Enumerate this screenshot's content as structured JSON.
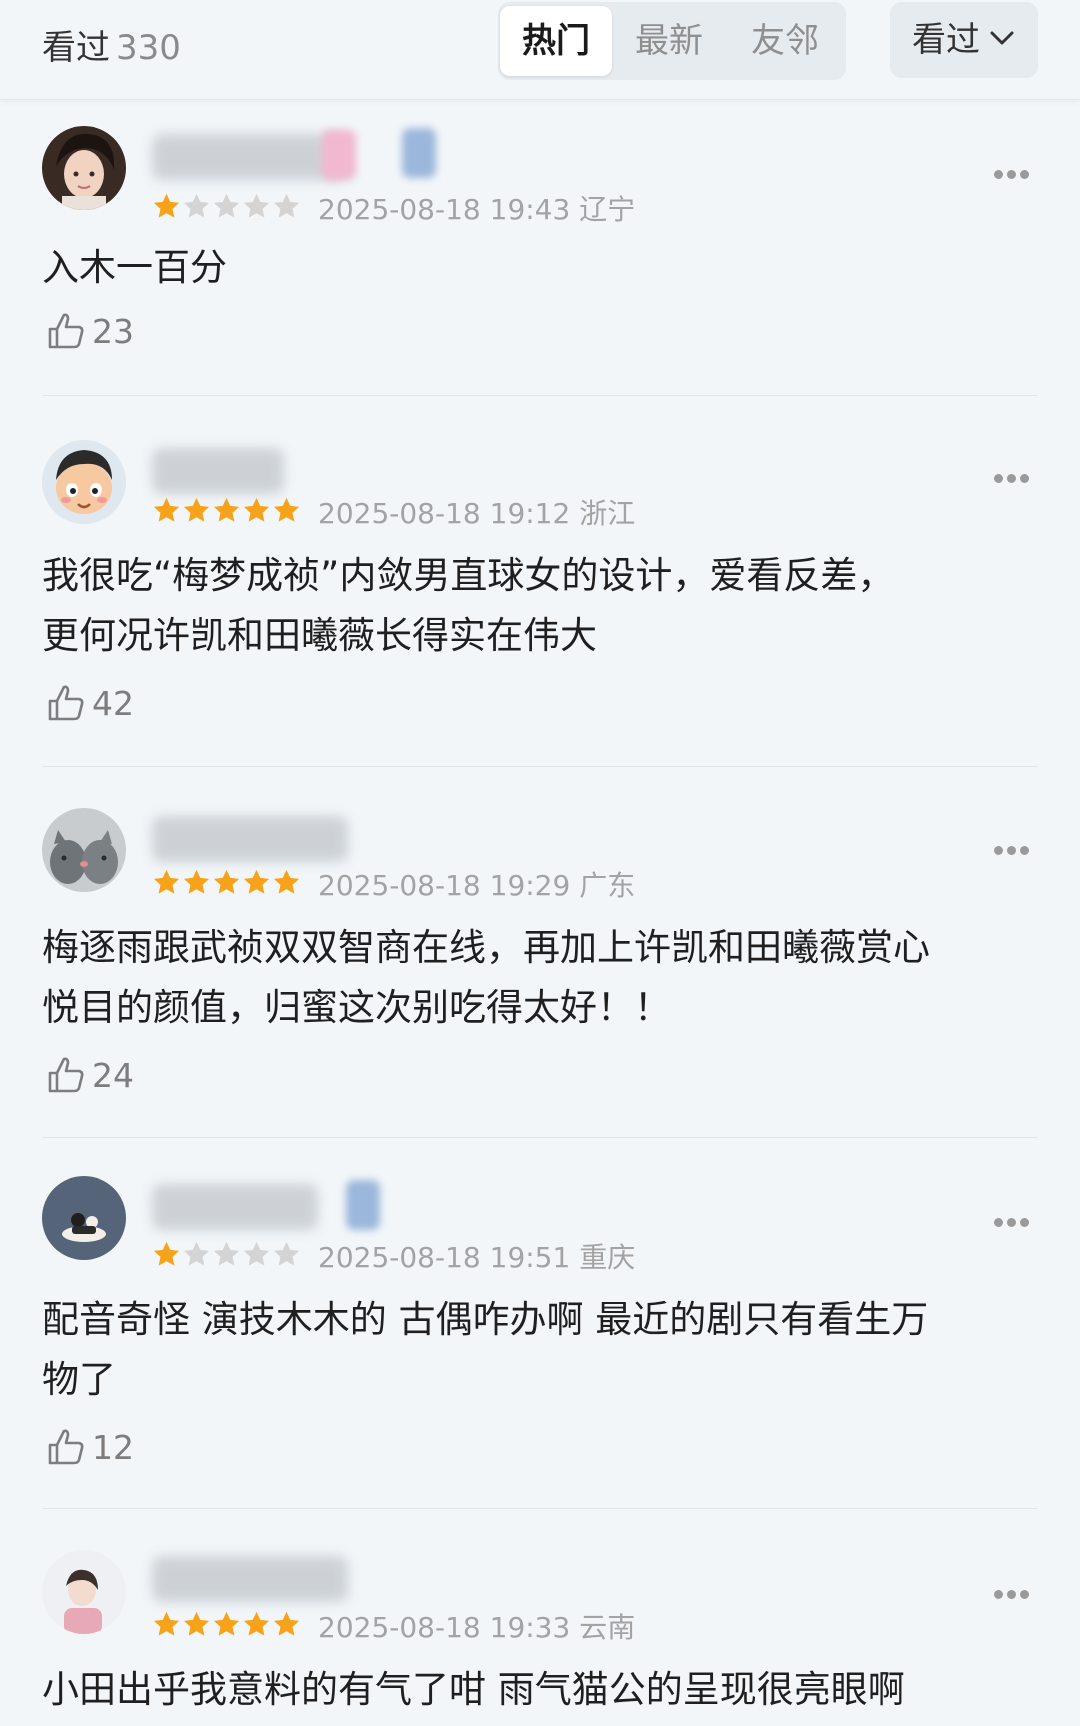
{
  "header": {
    "seen_label": "看过",
    "seen_count": "330",
    "tabs": [
      {
        "label": "热门",
        "active": true
      },
      {
        "label": "最新",
        "active": false
      },
      {
        "label": "友邻",
        "active": false
      }
    ],
    "filter_label": "看过"
  },
  "colors": {
    "star_filled": "#f7a21b",
    "star_empty": "#d4d4d4",
    "background": "#f2f6f9"
  },
  "comments": [
    {
      "rating": 1,
      "date": "2025-08-18 19:43",
      "region": "辽宁",
      "text": "入木一百分",
      "likes": "23"
    },
    {
      "rating": 5,
      "date": "2025-08-18 19:12",
      "region": "浙江",
      "text": "我很吃“梅梦成祯”内敛男直球女的设计，爱看反差，\n更何况许凯和田曦薇长得实在伟大",
      "likes": "42"
    },
    {
      "rating": 5,
      "date": "2025-08-18 19:29",
      "region": "广东",
      "text": "梅逐雨跟武祯双双智商在线，再加上许凯和田曦薇赏心\n悦目的颜值，归蜜这次别吃得太好！！",
      "likes": "24"
    },
    {
      "rating": 1,
      "date": "2025-08-18 19:51",
      "region": "重庆",
      "text": "配音奇怪 演技木木的 古偶咋办啊 最近的剧只有看生万\n物了",
      "likes": "12"
    },
    {
      "rating": 5,
      "date": "2025-08-18 19:33",
      "region": "云南",
      "text": "小田出乎我意料的有气了咁 雨气猫公的呈现很亮眼啊",
      "likes": ""
    }
  ]
}
